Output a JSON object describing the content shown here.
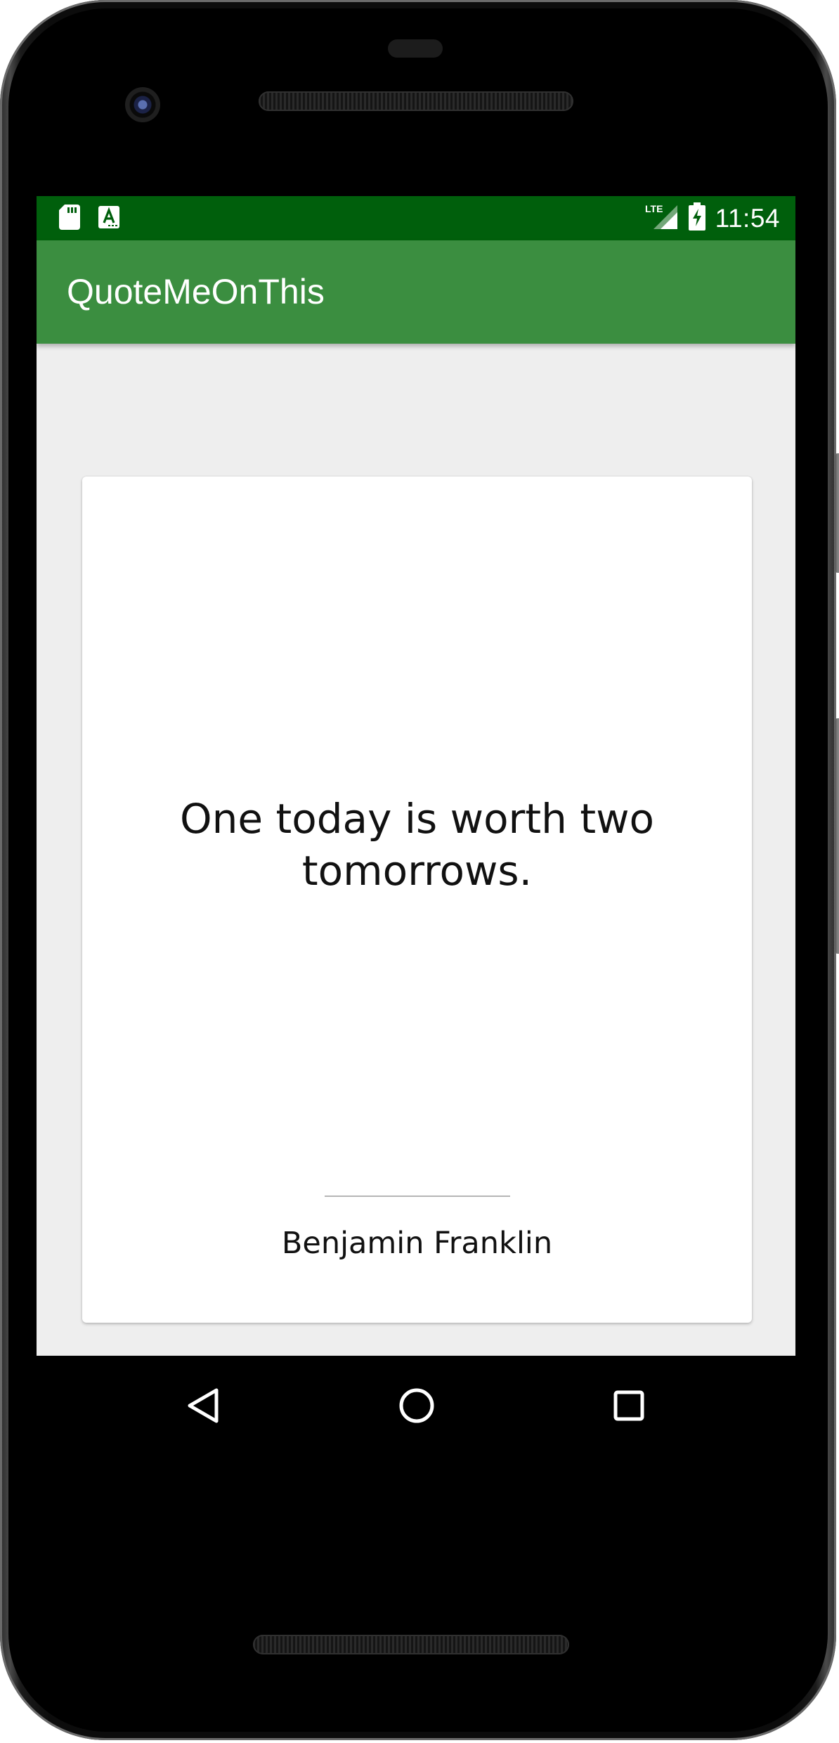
{
  "status_bar": {
    "time": "11:54",
    "network_label": "LTE",
    "background_color": "#005f0c",
    "icons": [
      "sd-card-icon",
      "a-notification-icon",
      "lte-signal-icon",
      "battery-charging-icon"
    ]
  },
  "app_bar": {
    "title": "QuoteMeOnThis",
    "background_color": "#3b8e40"
  },
  "quote_card": {
    "quote": "One today is worth two tomorrows.",
    "author": "Benjamin Franklin"
  },
  "nav_bar": {
    "buttons": [
      "back-icon",
      "home-icon",
      "recents-icon"
    ]
  }
}
